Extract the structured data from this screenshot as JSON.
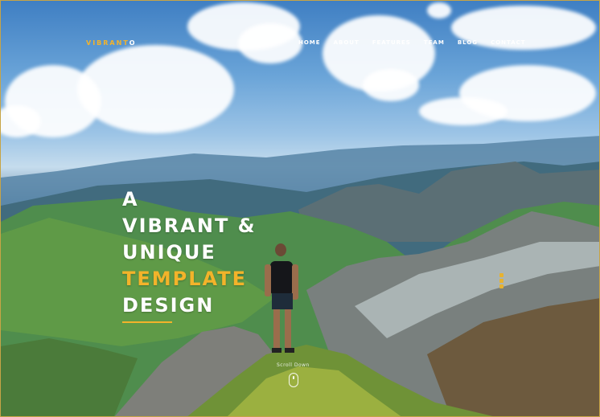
{
  "brand": {
    "logo_accent": "VIBRANT",
    "logo_rest": "O",
    "accent_color": "#f3b32a"
  },
  "nav": {
    "items": [
      "HOME",
      "ABOUT",
      "FEATURES",
      "TEAM",
      "BLOG",
      "CONTACT"
    ]
  },
  "hero": {
    "line1": "A",
    "line2": "VIBRANT &",
    "line3": "UNIQUE",
    "line4": "TEMPLATE",
    "line5": "DESIGN"
  },
  "scroll": {
    "label": "Scroll Down"
  }
}
